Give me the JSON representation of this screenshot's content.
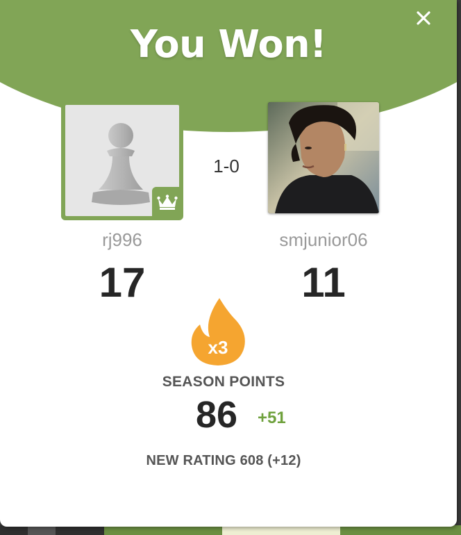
{
  "modal": {
    "title": "You Won!",
    "close_icon": "close-icon",
    "accent_color": "#81a556"
  },
  "players": {
    "left": {
      "username": "rj996",
      "points": "17",
      "avatar_icon": "pawn-icon",
      "badge_icon": "crown-icon"
    },
    "right": {
      "username": "smjunior06",
      "points": "11",
      "avatar": "profile-photo"
    }
  },
  "result": {
    "score": "1-0"
  },
  "season": {
    "multiplier": "x3",
    "label": "SEASON POINTS",
    "points": "86",
    "delta": "+51",
    "flame_color": "#f5a530"
  },
  "rating": {
    "text": "NEW RATING 608 (+12)"
  }
}
